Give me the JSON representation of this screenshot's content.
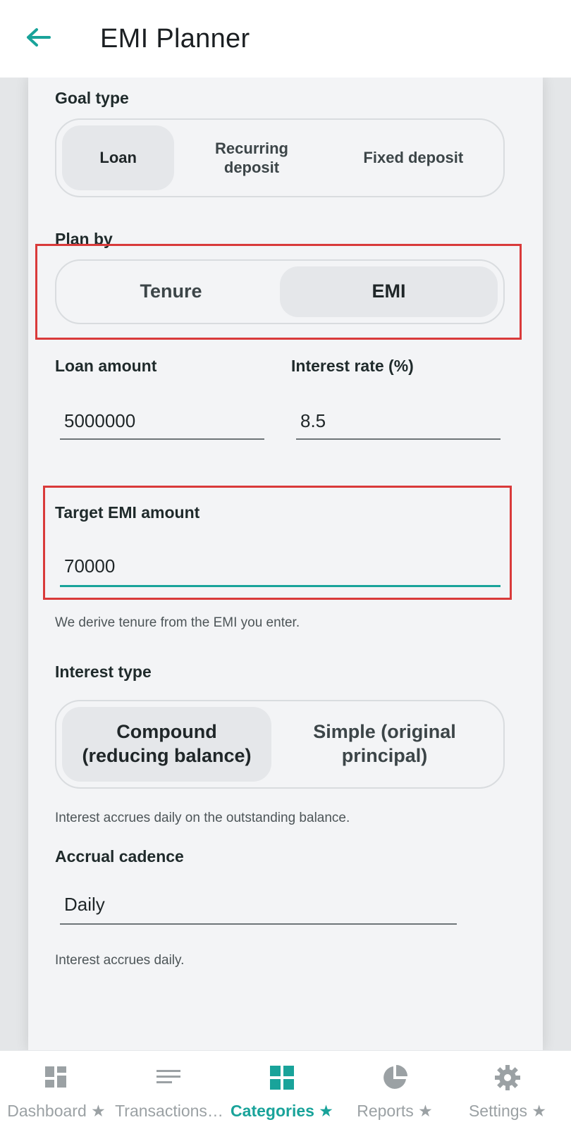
{
  "header": {
    "title": "EMI Planner"
  },
  "goal_type": {
    "label": "Goal type",
    "options": [
      "Loan",
      "Recurring deposit",
      "Fixed deposit"
    ],
    "selected": "Loan"
  },
  "plan_by": {
    "label": "Plan by",
    "options": [
      "Tenure",
      "EMI"
    ],
    "selected": "EMI"
  },
  "loan_amount": {
    "label": "Loan amount",
    "value": "5000000"
  },
  "interest_rate": {
    "label": "Interest rate (%)",
    "value": "8.5"
  },
  "target_emi": {
    "label": "Target EMI amount",
    "value": "70000",
    "helper": "We derive tenure from the EMI you enter."
  },
  "interest_type": {
    "label": "Interest type",
    "options": [
      "Compound (reducing balance)",
      "Simple (original principal)"
    ],
    "selected": "Compound (reducing balance)",
    "helper": "Interest accrues daily on the outstanding balance."
  },
  "accrual_cadence": {
    "label": "Accrual cadence",
    "value": "Daily",
    "helper": "Interest accrues daily."
  },
  "bottom_nav": {
    "items": [
      {
        "label": "Dashboard ★",
        "icon": "dashboard-icon"
      },
      {
        "label": "Transactions…",
        "icon": "list-icon"
      },
      {
        "label": "Categories ★",
        "icon": "grid-icon"
      },
      {
        "label": "Reports ★",
        "icon": "pie-chart-icon"
      },
      {
        "label": "Settings ★",
        "icon": "gear-icon"
      }
    ],
    "active": "Categories ★"
  },
  "colors": {
    "accent": "#19a39a",
    "highlight": "#d93a3a",
    "text": "#1f2a2b"
  }
}
